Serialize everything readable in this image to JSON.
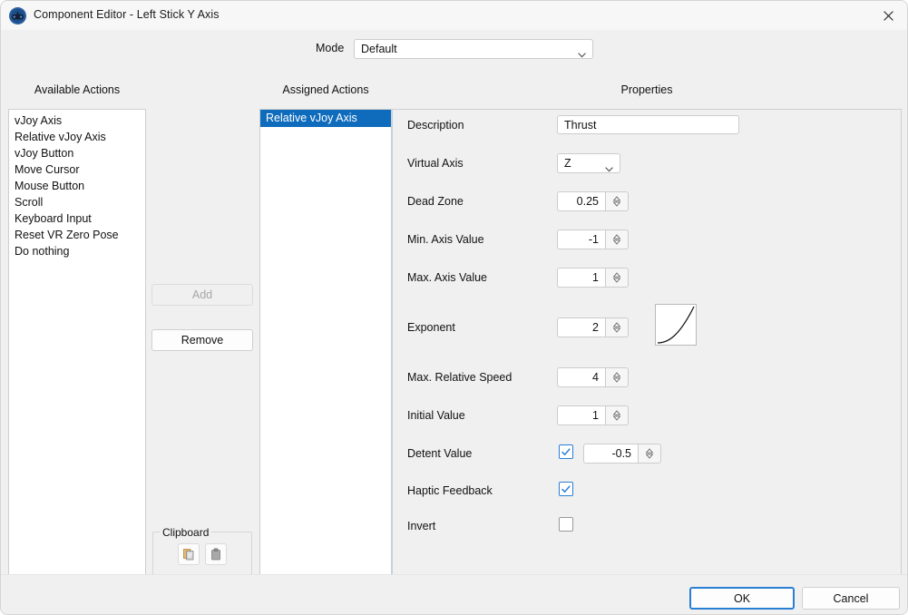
{
  "window": {
    "title": "Component Editor - Left Stick Y Axis",
    "app_icon": "gamepad-icon",
    "close_icon": "close-icon"
  },
  "mode": {
    "label": "Mode",
    "value": "Default"
  },
  "columns": {
    "available_header": "Available Actions",
    "assigned_header": "Assigned Actions",
    "properties_header": "Properties"
  },
  "available_actions": [
    "vJoy Axis",
    "Relative vJoy Axis",
    "vJoy Button",
    "Move Cursor",
    "Mouse Button",
    "Scroll",
    "Keyboard Input",
    "Reset VR Zero Pose",
    "Do nothing"
  ],
  "assigned_actions": [
    "Relative vJoy Axis"
  ],
  "buttons": {
    "add": "Add",
    "remove": "Remove",
    "ok": "OK",
    "cancel": "Cancel"
  },
  "clipboard": {
    "legend": "Clipboard",
    "copy_icon": "copy-icon",
    "paste_icon": "paste-icon"
  },
  "properties": {
    "description": {
      "label": "Description",
      "value": "Thrust"
    },
    "virtual_axis": {
      "label": "Virtual Axis",
      "value": "Z"
    },
    "dead_zone": {
      "label": "Dead Zone",
      "value": "0.25"
    },
    "min_axis_value": {
      "label": "Min. Axis Value",
      "value": "-1"
    },
    "max_axis_value": {
      "label": "Max. Axis Value",
      "value": "1"
    },
    "exponent": {
      "label": "Exponent",
      "value": "2"
    },
    "max_relative_speed": {
      "label": "Max. Relative Speed",
      "value": "4"
    },
    "initial_value": {
      "label": "Initial Value",
      "value": "1"
    },
    "detent_value": {
      "label": "Detent Value",
      "value": "-0.5",
      "checked": true
    },
    "haptic_feedback": {
      "label": "Haptic Feedback",
      "checked": true
    },
    "invert": {
      "label": "Invert",
      "checked": false
    }
  },
  "colors": {
    "accent": "#0f6cbd",
    "focus": "#2a7fd4",
    "window_bg": "#f0f0f0"
  }
}
